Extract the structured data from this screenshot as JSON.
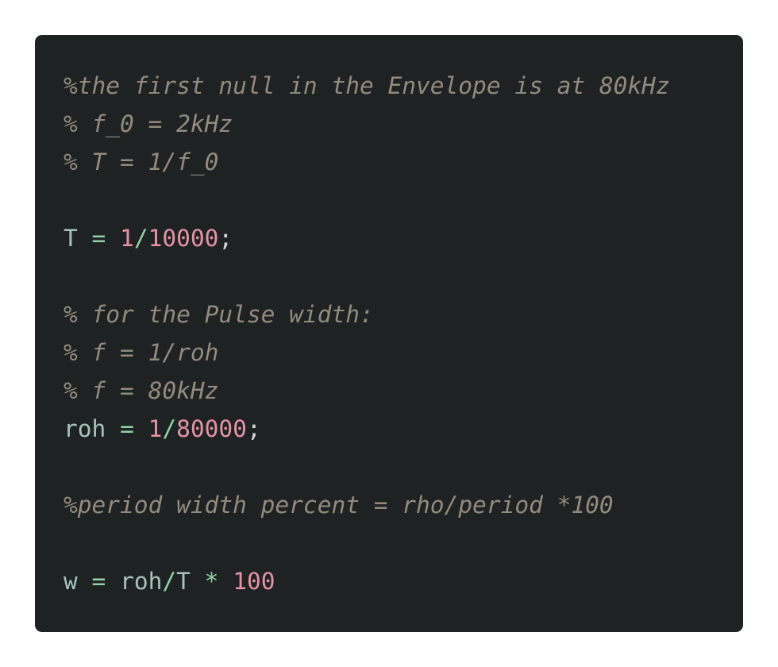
{
  "code": {
    "language": "MATLAB",
    "colors": {
      "background": "#1f2223",
      "comment": "#938a7e",
      "identifier": "#a6c4b8",
      "operator": "#8fd3a5",
      "number": "#e791a6",
      "punctuation": "#d7d7d7"
    },
    "lines": [
      [
        {
          "t": "%the first null in the Envelope is at 80kHz",
          "k": "comment"
        }
      ],
      [
        {
          "t": "% f_0 = 2kHz",
          "k": "comment"
        }
      ],
      [
        {
          "t": "% T = 1/f_0",
          "k": "comment"
        }
      ],
      [],
      [
        {
          "t": "T",
          "k": "ident"
        },
        {
          "t": " ",
          "k": "space"
        },
        {
          "t": "=",
          "k": "op"
        },
        {
          "t": " ",
          "k": "space"
        },
        {
          "t": "1",
          "k": "num"
        },
        {
          "t": "/",
          "k": "op"
        },
        {
          "t": "10000",
          "k": "num"
        },
        {
          "t": ";",
          "k": "punct"
        }
      ],
      [],
      [
        {
          "t": "% for the Pulse width:",
          "k": "comment"
        }
      ],
      [
        {
          "t": "% f = 1/roh",
          "k": "comment"
        }
      ],
      [
        {
          "t": "% f = 80kHz",
          "k": "comment"
        }
      ],
      [
        {
          "t": "roh",
          "k": "ident"
        },
        {
          "t": " ",
          "k": "space"
        },
        {
          "t": "=",
          "k": "op"
        },
        {
          "t": " ",
          "k": "space"
        },
        {
          "t": "1",
          "k": "num"
        },
        {
          "t": "/",
          "k": "op"
        },
        {
          "t": "80000",
          "k": "num"
        },
        {
          "t": ";",
          "k": "punct"
        }
      ],
      [],
      [
        {
          "t": "%period width percent = rho/period *100",
          "k": "comment"
        }
      ],
      [],
      [
        {
          "t": "w",
          "k": "ident"
        },
        {
          "t": " ",
          "k": "space"
        },
        {
          "t": "=",
          "k": "op"
        },
        {
          "t": " ",
          "k": "space"
        },
        {
          "t": "roh",
          "k": "ident"
        },
        {
          "t": "/",
          "k": "op"
        },
        {
          "t": "T",
          "k": "ident"
        },
        {
          "t": " ",
          "k": "space"
        },
        {
          "t": "*",
          "k": "op"
        },
        {
          "t": " ",
          "k": "space"
        },
        {
          "t": "100",
          "k": "num"
        }
      ]
    ]
  }
}
